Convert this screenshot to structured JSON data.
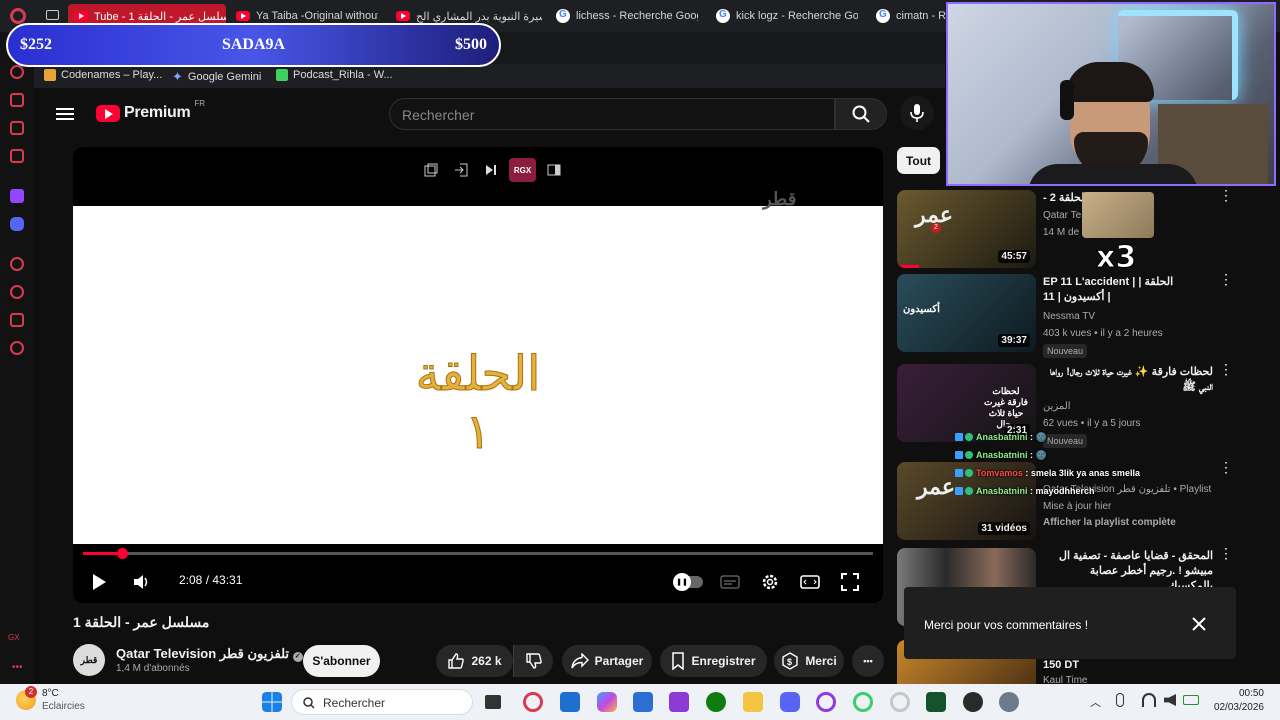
{
  "browser": {
    "tabs": [
      {
        "label": "Tube - 1 مسلسل عمر - الحلقة",
        "icon": "youtube-icon",
        "active": true
      },
      {
        "label": "Ya Taiba -Original without",
        "icon": "youtube-icon",
        "active": false
      },
      {
        "label": "السيرة النبوية بدر المشاري الح",
        "icon": "youtube-icon",
        "active": false
      },
      {
        "label": "lichess - Recherche Goog",
        "icon": "google-icon",
        "active": false
      },
      {
        "label": "kick logz - Recherche Goo",
        "icon": "google-icon",
        "active": false
      },
      {
        "label": "cimatn - Re",
        "icon": "google-icon",
        "active": false
      }
    ],
    "bookmarks": [
      {
        "label": "Codenames – Play...",
        "color": "#e8a33a"
      },
      {
        "label": "Google Gemini",
        "color": "#7aa7ff"
      },
      {
        "label": "Podcast_Rihla - W...",
        "color": "#3fd15e"
      }
    ]
  },
  "stream_overlay": {
    "left_amount": "$252",
    "name": "SADA9A",
    "right_amount": "$500"
  },
  "header": {
    "logo_text": "Premium",
    "logo_region": "FR",
    "search_placeholder": "Rechercher"
  },
  "player": {
    "tools": [
      "pip-icon",
      "exit-icon",
      "skip-icon",
      "RGX",
      "sidebar-icon"
    ],
    "watermark": "قطر",
    "arabic_word": "الحلقة",
    "episode_number": "١",
    "current_time": "2:08",
    "duration": "43:31",
    "time_display": "2:08 / 43:31",
    "progress_fraction": 0.049
  },
  "video": {
    "title": "مسلسل عمر - الحلقة 1",
    "channel_name": "Qatar Television تلفزيون قطر",
    "channel_avatar_text": "قطر",
    "subscribers": "1,4 M d'abonnés",
    "subscribe_label": "S'abonner",
    "likes": "262 k",
    "share_label": "Partager",
    "save_label": "Enregistrer",
    "thanks_label": "Merci",
    "more_label": "•••"
  },
  "chips": {
    "all": "Tout"
  },
  "recommendations": [
    {
      "title": "الحلقة 2 - ",
      "channel": "Qatar Te",
      "meta": "14 M de",
      "duration": "45:57",
      "badge": "",
      "thumb_colors": [
        "#6b5a2f",
        "#1c1a12"
      ]
    },
    {
      "title": "EP 11 L'accident  | الحلقة | أكسيدون | 11 |",
      "channel": "Nessma TV",
      "meta": "403 k vues • il y a 2 heures",
      "duration": "39:37",
      "badge": "Nouveau",
      "thumb_colors": [
        "#2a4d5a",
        "#0d1a20"
      ]
    },
    {
      "title": "لحظات فارقة ✨ غيرت حياة ثلاث رجال! رواها النبي ﷺ",
      "channel": "المزين",
      "meta": "62 vues • il y a 5 jours",
      "duration": "2:31",
      "badge": "Nouveau",
      "thumb_colors": [
        "#3a1e3a",
        "#141414"
      ]
    },
    {
      "title": "",
      "channel": "Qatar Television تلفزيون قطر",
      "meta": "Mise à jour hier",
      "duration": "31 vidéos",
      "badge": "",
      "playlist": "Playlist",
      "link": "Afficher la playlist complète",
      "thumb_colors": [
        "#5a4a2a",
        "#151210"
      ]
    },
    {
      "title": "المحقق - قضايا عاصفة - تصفية ال مبيشو ! .رجيم أخطر عصابة بالمكسيك",
      "channel": "",
      "meta": "",
      "duration": "",
      "badge": "",
      "thumb_colors": [
        "#6a6a6a",
        "#222"
      ]
    },
    {
      "title": "150 DT",
      "channel": "Kaul Time",
      "meta": "",
      "duration": "",
      "badge": "",
      "thumb_colors": [
        "#c8862a",
        "#3a2410"
      ]
    }
  ],
  "chat": [
    {
      "user": "Anasbatnini",
      "msg": ": 🌚"
    },
    {
      "user": "Anasbatnini",
      "msg": ": 🌚"
    },
    {
      "user": "Tomvamos",
      "msg": ": smela 3lik ya anas smella"
    },
    {
      "user": "Anasbatnini",
      "msg": ": mayodhherch"
    }
  ],
  "emote_multiplier": "x3",
  "toast": {
    "message": "Merci pour vos commentaires !"
  },
  "taskbar": {
    "temperature": "8°C",
    "condition": "Eclaircies",
    "weather_badge": "2",
    "search_placeholder": "Rechercher",
    "time": "00:50",
    "date": "02/03/2026"
  },
  "sidebar_footer": "GX"
}
